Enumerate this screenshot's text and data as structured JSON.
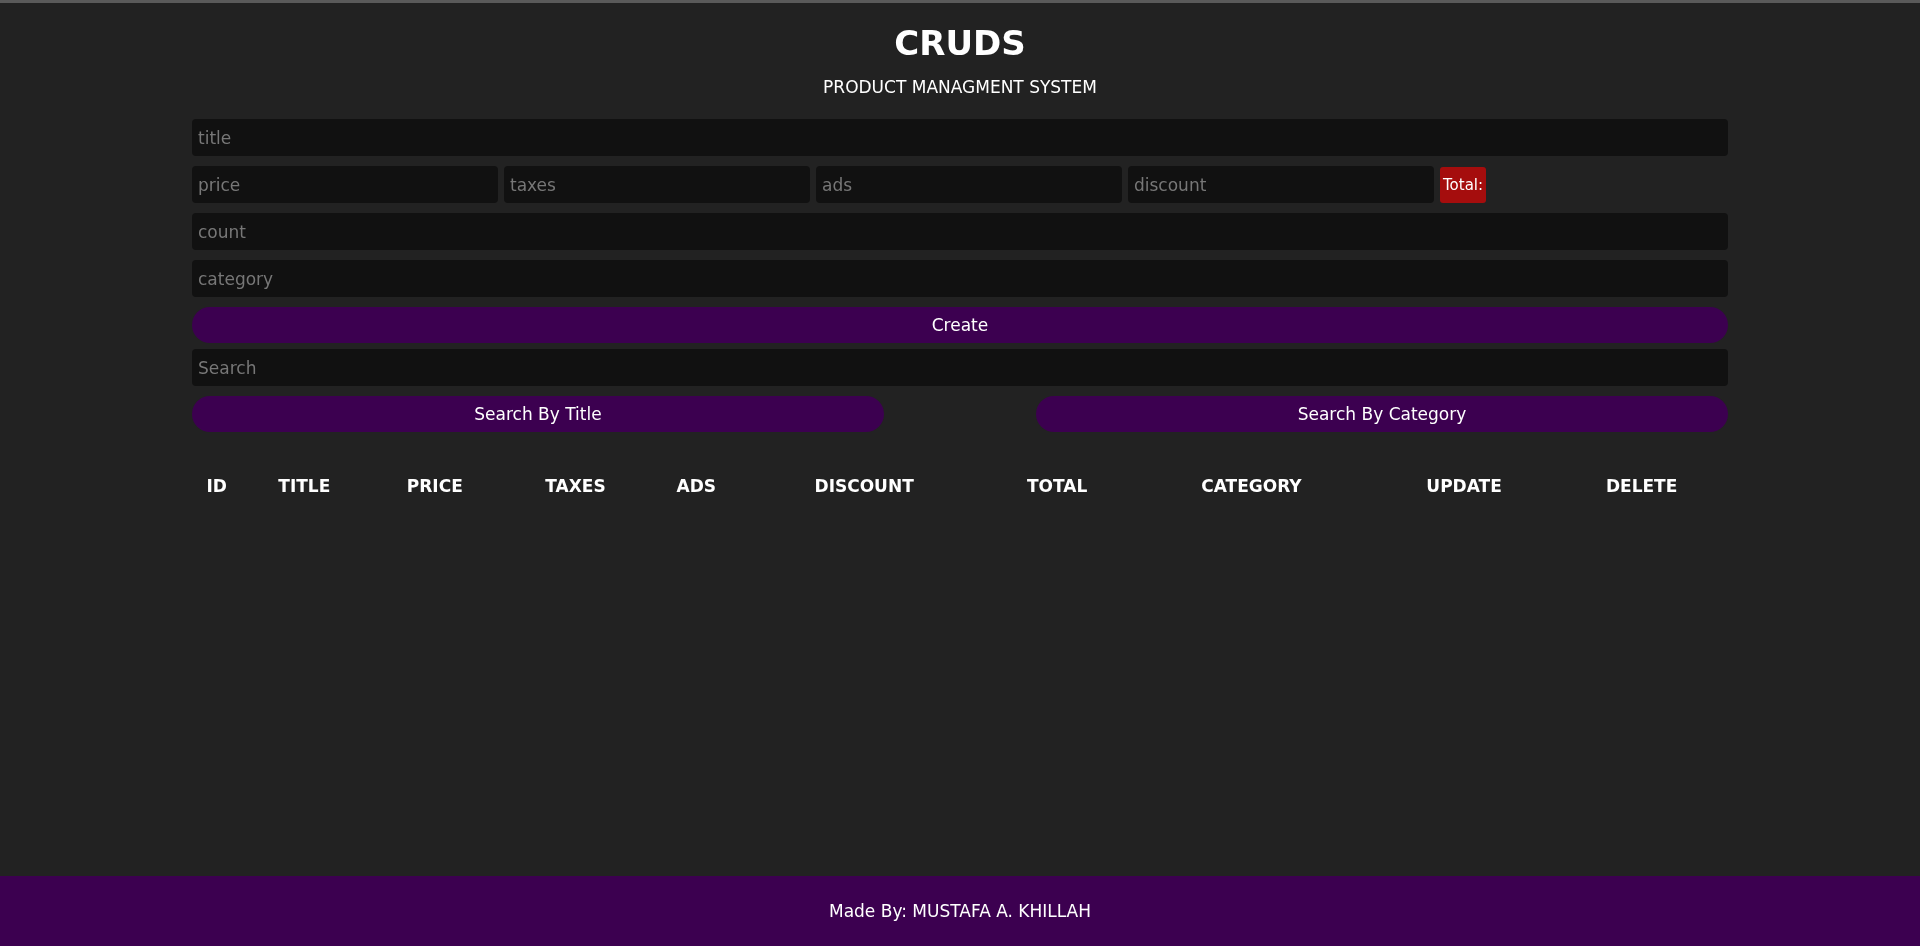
{
  "header": {
    "title": "CRUDS",
    "subtitle": "PRODUCT MANAGMENT SYSTEM"
  },
  "form": {
    "title": {
      "placeholder": "title"
    },
    "prices": [
      {
        "placeholder": "price"
      },
      {
        "placeholder": "taxes"
      },
      {
        "placeholder": "ads"
      },
      {
        "placeholder": "discount"
      }
    ],
    "total": "Total:",
    "count": {
      "placeholder": "count"
    },
    "category": {
      "placeholder": "category"
    },
    "create_button": "Create"
  },
  "search": {
    "placeholder": "Search",
    "buttons": [
      "Search By Title",
      "Search By Category"
    ]
  },
  "table": {
    "columns": [
      "ID",
      "TITLE",
      "PRICE",
      "TAXES",
      "ADS",
      "DISCOUNT",
      "TOTAL",
      "CATEGORY",
      "UPDATE",
      "DELETE"
    ]
  },
  "footer": "Made By: MUSTAFA A. KHILLAH"
}
